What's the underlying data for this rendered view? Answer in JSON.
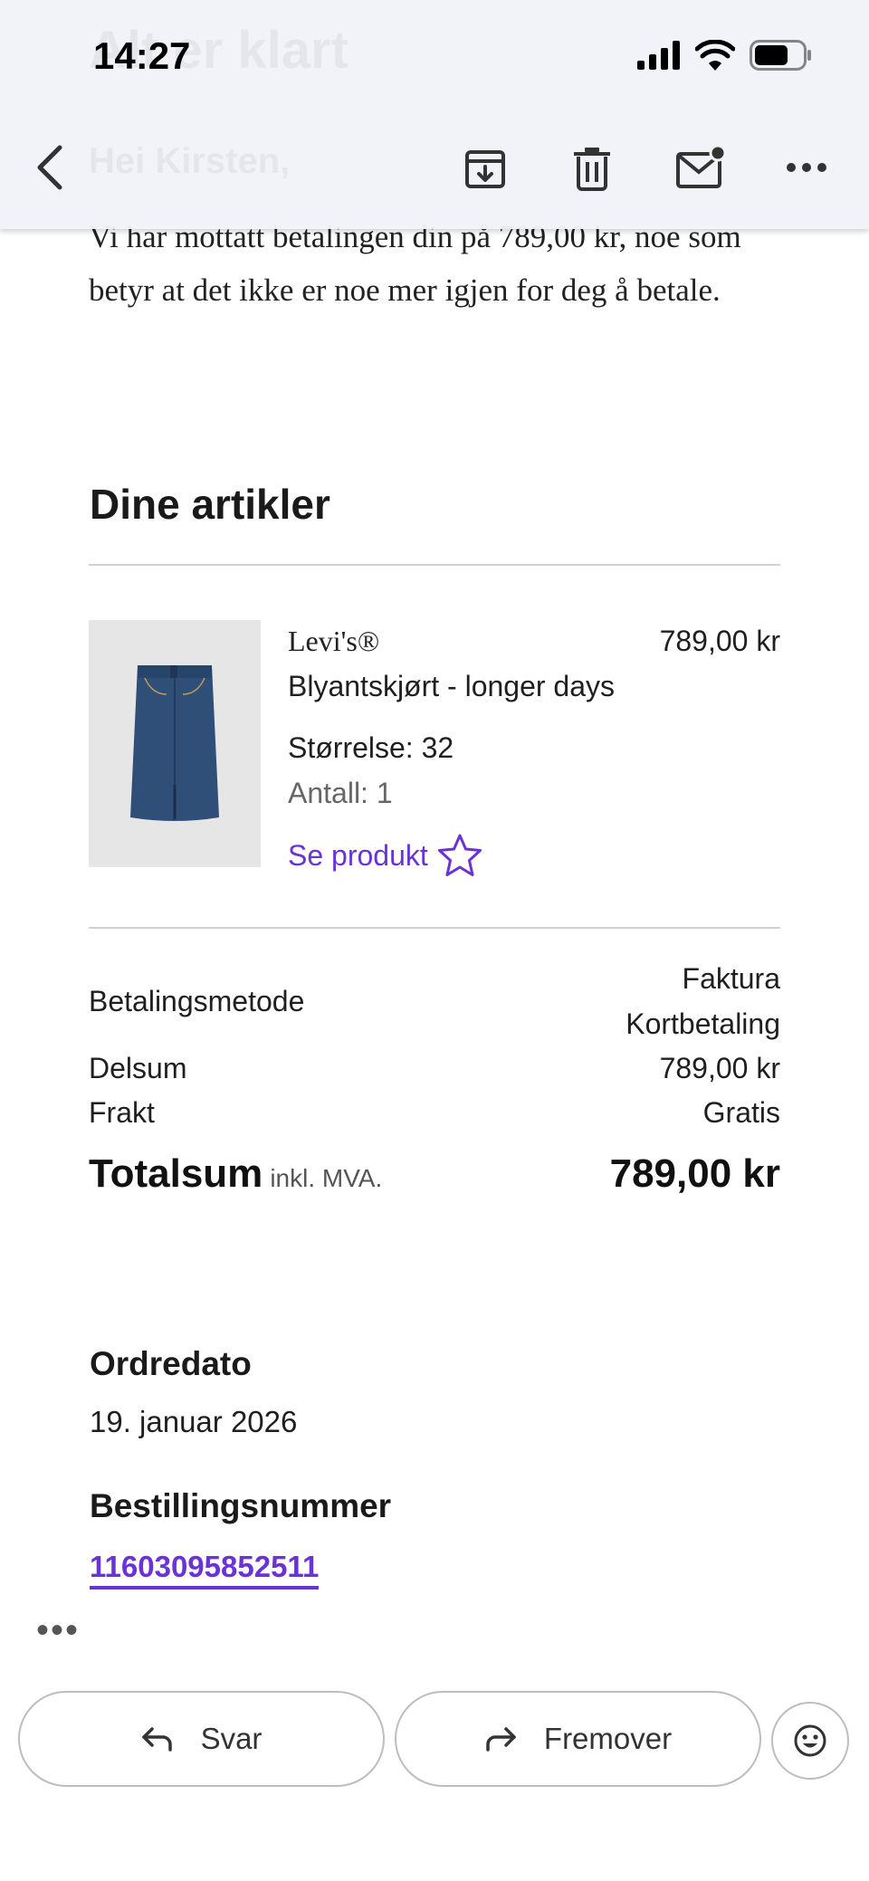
{
  "header": {
    "ghost_title": "Alt er klart",
    "ghost_greeting": "Hei Kirsten,",
    "time": "14:27"
  },
  "email": {
    "intro": "Vi har mottatt betalingen din på 789,00 kr, noe som betyr at det ikke er noe mer igjen for deg å betale.",
    "items_title": "Dine artikler",
    "item": {
      "brand": "Levi's®",
      "name": "Blyantskjørt - longer days",
      "price": "789,00 kr",
      "size": "Størrelse: 32",
      "quantity": "Antall: 1",
      "link_label": "Se produkt"
    },
    "summary": {
      "payment_label": "Betalingsmetode",
      "payment_value_1": "Faktura",
      "payment_value_2": "Kortbetaling",
      "subtotal_label": "Delsum",
      "subtotal_value": "789,00 kr",
      "shipping_label": "Frakt",
      "shipping_value": "Gratis",
      "total_label": "Totalsum",
      "total_sub": "inkl. MVA.",
      "total_value": "789,00 kr"
    },
    "order_date_label": "Ordredato",
    "order_date": "19. januar 2026",
    "order_number_label": "Bestillingsnummer",
    "order_number": "11603095852511"
  },
  "actions": {
    "reply": "Svar",
    "forward": "Fremover"
  },
  "colors": {
    "accent": "#6a33d6",
    "header_bg": "#f0f3f8"
  }
}
